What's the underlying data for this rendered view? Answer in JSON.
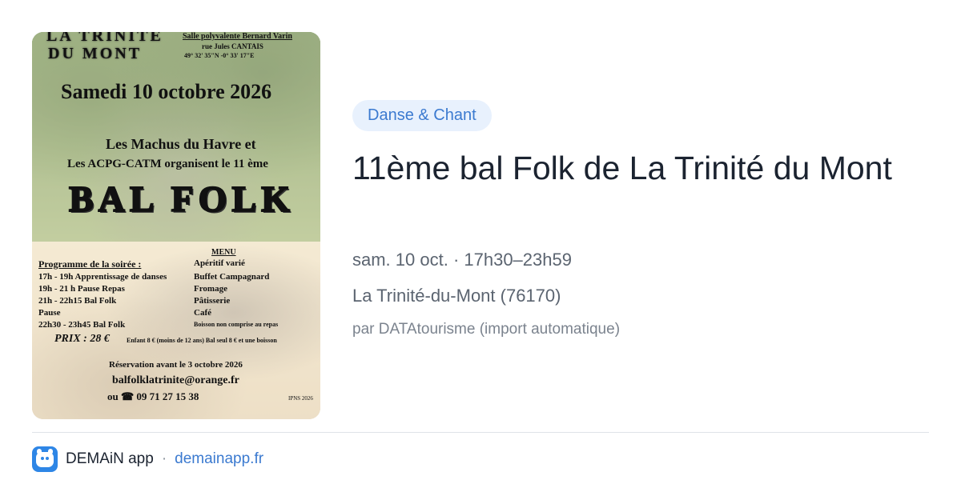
{
  "poster": {
    "top_title_line1": "LA TRINITE",
    "top_title_line2": "DU   MONT",
    "venue_name": "Salle polyvalente Bernard Varin",
    "venue_street": "rue Jules CANTAIS",
    "venue_coords": "49° 32' 35\"N -0° 33' 17\"E",
    "date": "Samedi 10 octobre 2026",
    "organizers_line1": "Les Machus du Havre et",
    "organizers_line2": "Les ACPG-CATM organisent le 11 ème",
    "headline": "BAL FOLK",
    "program_title": "Programme de la soirée   :",
    "program": [
      "17h - 19h Apprentissage de danses",
      "19h - 21 h   Pause Repas",
      "21h - 22h15 Bal Folk",
      "Pause",
      "22h30 - 23h45 Bal Folk"
    ],
    "menu_title": "MENU",
    "menu": [
      "Apéritif varié",
      "Buffet Campagnard",
      "Fromage",
      "Pâtisserie",
      "Café",
      "Boisson non comprise au repas"
    ],
    "price": "PRIX : 28 €",
    "price_note": "Enfant 8 € (moins de 12 ans) Bal seul  8 € et une boisson",
    "reservation": "Réservation avant le 3 octobre 2026",
    "email": "balfolklatrinite@orange.fr",
    "phone": "ou ☎  09 71 27 15 38",
    "credit": "IPNS 2026"
  },
  "event": {
    "category": "Danse & Chant",
    "title": "11ème bal Folk de La Trinité du Mont",
    "date_time": "sam. 10 oct. · 17h30–23h59",
    "location": "La Trinité-du-Mont (76170)",
    "source": "par DATAtourisme (import automatique)"
  },
  "footer": {
    "app_name": "DEMAiN app",
    "separator": "·",
    "domain": "demainapp.fr",
    "icon": "demain-app-icon"
  },
  "colors": {
    "accent": "#3b7ad0",
    "pill_background": "#e8f1fd",
    "title_text": "#1b2330",
    "muted_text": "#5b6470"
  }
}
